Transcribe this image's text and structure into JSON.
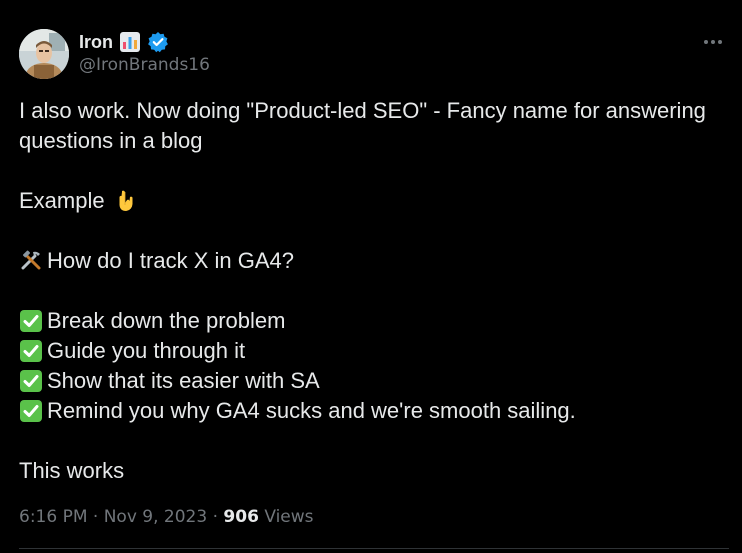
{
  "author": {
    "display_name": "Iron",
    "handle": "@IronBrands16",
    "name_emoji": "bar-chart-emoji",
    "verified": true,
    "verified_color": "#1d9bf0"
  },
  "tweet": {
    "lines": [
      "I also work. Now doing \"Product-led SEO\" - Fancy name for answering",
      "questions in a blog",
      "Example",
      "How do I track X in GA4?",
      "Break down the problem",
      "Guide you through it",
      "Show that its easier with SA",
      "Remind you why GA4 sucks and we're smooth sailing.",
      "This works"
    ]
  },
  "meta": {
    "time": "6:16 PM",
    "separator": "·",
    "date": "Nov 9, 2023",
    "views_count": "906",
    "views_label": "Views"
  },
  "icons": {
    "more": "more-horizontal-icon",
    "pointing_down": "backhand-index-pointing-down-emoji",
    "tools": "hammer-and-wrench-emoji",
    "check": "check-mark-button-emoji"
  },
  "colors": {
    "background": "#000000",
    "text": "#e7e9ea",
    "secondary_text": "#71767b",
    "check_green": "#5ac24a"
  }
}
